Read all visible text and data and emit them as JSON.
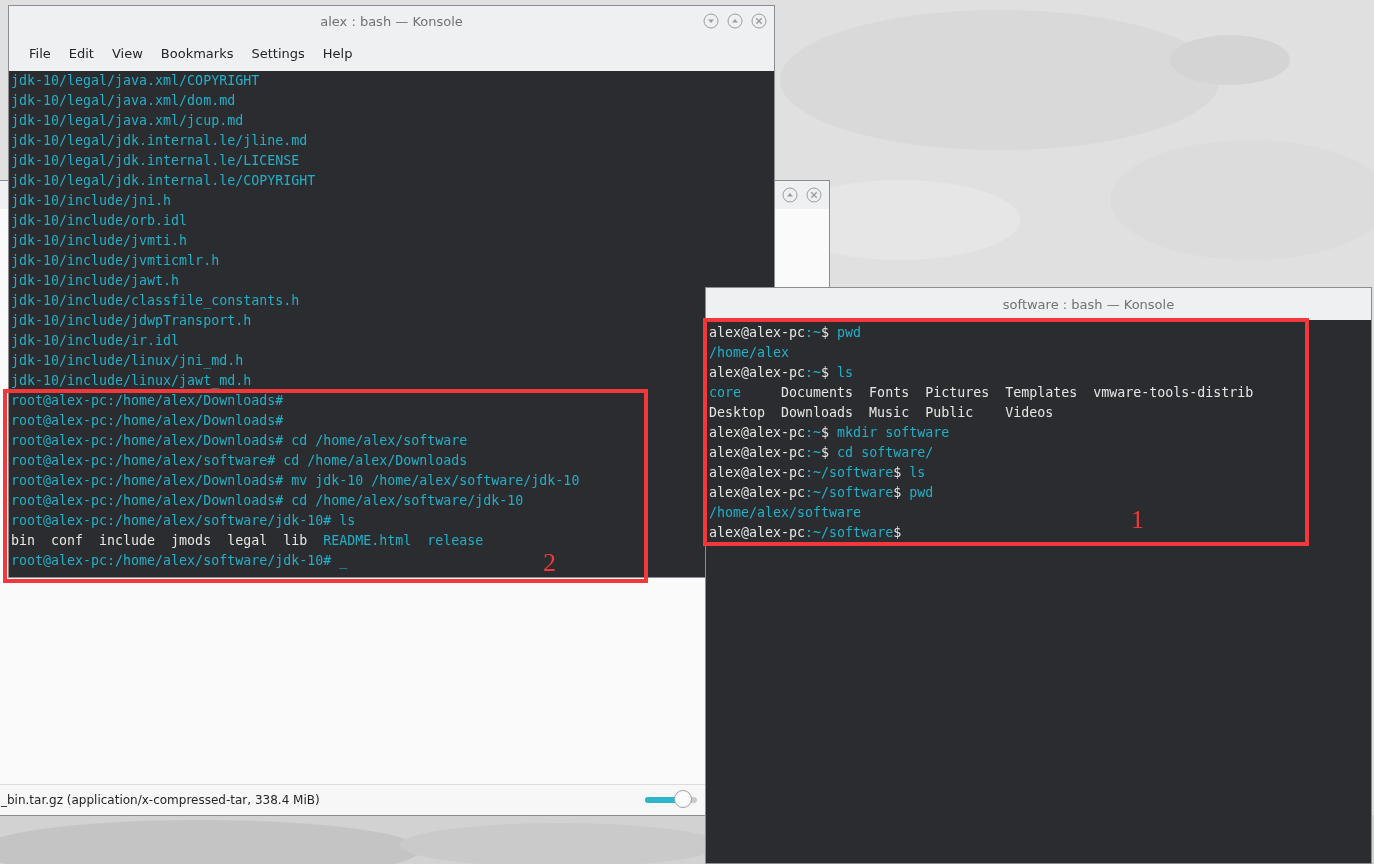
{
  "background_window": {
    "status_text": "_bin.tar.gz (application/x-compressed-tar, 338.4 MiB)",
    "progress": {
      "level": 0.85
    }
  },
  "left_konsole": {
    "title": "alex : bash — Konsole",
    "menu": [
      "File",
      "Edit",
      "View",
      "Bookmarks",
      "Settings",
      "Help"
    ],
    "lines": [
      [
        {
          "text": "jdk-10/legal/java.xml/COPYRIGHT",
          "highlighted": true
        }
      ],
      [
        {
          "text": "jdk-10/legal/java.xml/dom.md",
          "highlighted": true
        }
      ],
      [
        {
          "text": "jdk-10/legal/java.xml/jcup.md",
          "highlighted": true
        }
      ],
      [
        {
          "text": "jdk-10/legal/jdk.internal.le/jline.md",
          "highlighted": true
        }
      ],
      [
        {
          "text": "jdk-10/legal/jdk.internal.le/LICENSE",
          "highlighted": true
        }
      ],
      [
        {
          "text": "jdk-10/legal/jdk.internal.le/COPYRIGHT",
          "highlighted": true
        }
      ],
      [
        {
          "text": "jdk-10/include/jni.h",
          "highlighted": true
        }
      ],
      [
        {
          "text": "jdk-10/include/orb.idl",
          "highlighted": true
        }
      ],
      [
        {
          "text": "jdk-10/include/jvmti.h",
          "highlighted": true
        }
      ],
      [
        {
          "text": "jdk-10/include/jvmticmlr.h",
          "highlighted": true
        }
      ],
      [
        {
          "text": "jdk-10/include/jawt.h",
          "highlighted": true
        }
      ],
      [
        {
          "text": "jdk-10/include/classfile_constants.h",
          "highlighted": true
        }
      ],
      [
        {
          "text": "jdk-10/include/jdwpTransport.h",
          "highlighted": true
        }
      ],
      [
        {
          "text": "jdk-10/include/ir.idl",
          "highlighted": true
        }
      ],
      [
        {
          "text": "jdk-10/include/linux/jni_md.h",
          "highlighted": true
        }
      ],
      [
        {
          "text": "jdk-10/include/linux/jawt_md.h",
          "highlighted": true
        }
      ],
      [
        {
          "text": "root@alex-pc:/home/alex/Downloads#",
          "highlighted": true
        }
      ],
      [
        {
          "text": "root@alex-pc:/home/alex/Downloads#",
          "highlighted": true
        }
      ],
      [
        {
          "text": "root@alex-pc:/home/alex/Downloads# cd /home/alex/software",
          "highlighted": true
        }
      ],
      [
        {
          "text": "root@alex-pc:/home/alex/software# cd /home/alex/Downloads",
          "highlighted": true
        }
      ],
      [
        {
          "text": "root@alex-pc:/home/alex/Downloads# mv jdk-10 /home/alex/software/jdk-10",
          "highlighted": true
        }
      ],
      [
        {
          "text": "root@alex-pc:/home/alex/Downloads# cd /home/alex/software/jdk-10",
          "highlighted": true
        }
      ],
      [
        {
          "text": "root@alex-pc:/home/alex/software/jdk-10# ls",
          "highlighted": true
        }
      ],
      [
        {
          "text": "bin  conf  include  jmods  legal  lib  ",
          "highlighted": false
        },
        {
          "text": "README.html  release",
          "highlighted": true
        }
      ],
      [
        {
          "text": "root@alex-pc:/home/alex/software/jdk-10# _",
          "highlighted": true
        }
      ]
    ]
  },
  "right_konsole": {
    "title": "software : bash — Konsole",
    "lines": [
      [
        {
          "text": "alex@alex-pc",
          "highlighted": false
        },
        {
          "text": ":~",
          "highlighted": true
        },
        {
          "text": "$ ",
          "highlighted": false
        },
        {
          "text": "pwd",
          "highlighted": true
        }
      ],
      [
        {
          "text": "/home/alex",
          "highlighted": true
        }
      ],
      [
        {
          "text": "alex@alex-pc",
          "highlighted": false
        },
        {
          "text": ":~",
          "highlighted": true
        },
        {
          "text": "$ ",
          "highlighted": false
        },
        {
          "text": "ls",
          "highlighted": true
        }
      ],
      [
        {
          "text": "core",
          "highlighted": true
        },
        {
          "text": "     Documents  Fonts  Pictures  Templates  vmware-tools-distrib",
          "highlighted": false
        }
      ],
      [
        {
          "text": "Desktop  Downloads  Music  Public    Videos",
          "highlighted": false
        }
      ],
      [
        {
          "text": "alex@alex-pc",
          "highlighted": false
        },
        {
          "text": ":~",
          "highlighted": true
        },
        {
          "text": "$ ",
          "highlighted": false
        },
        {
          "text": "mkdir software",
          "highlighted": true
        }
      ],
      [
        {
          "text": "alex@alex-pc",
          "highlighted": false
        },
        {
          "text": ":~",
          "highlighted": true
        },
        {
          "text": "$ ",
          "highlighted": false
        },
        {
          "text": "cd software/",
          "highlighted": true
        }
      ],
      [
        {
          "text": "alex@alex-pc",
          "highlighted": false
        },
        {
          "text": ":~/software",
          "highlighted": true
        },
        {
          "text": "$ ",
          "highlighted": false
        },
        {
          "text": "ls",
          "highlighted": true
        }
      ],
      [
        {
          "text": "alex@alex-pc",
          "highlighted": false
        },
        {
          "text": ":~/software",
          "highlighted": true
        },
        {
          "text": "$ ",
          "highlighted": false
        },
        {
          "text": "pwd",
          "highlighted": true
        }
      ],
      [
        {
          "text": "/home/alex/software",
          "highlighted": true
        }
      ],
      [
        {
          "text": "alex@alex-pc",
          "highlighted": false
        },
        {
          "text": ":~/software",
          "highlighted": true
        },
        {
          "text": "$",
          "highlighted": false
        }
      ]
    ]
  },
  "annotations": [
    {
      "label": "2"
    },
    {
      "label": "1"
    }
  ]
}
